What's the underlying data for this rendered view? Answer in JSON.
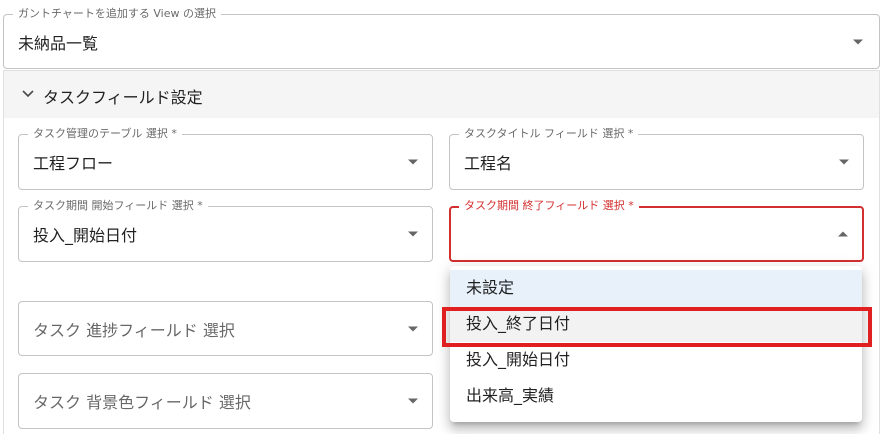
{
  "view_select": {
    "label": "ガントチャートを追加する View の選択",
    "value": "未納品一覧"
  },
  "section": {
    "title": "タスクフィールド設定"
  },
  "fields": {
    "task_table": {
      "label": "タスク管理のテーブル 選択 *",
      "value": "工程フロー"
    },
    "task_title": {
      "label": "タスクタイトル フィールド 選択 *",
      "value": "工程名"
    },
    "start_field": {
      "label": "タスク期間 開始フィールド 選択 *",
      "value": "投入_開始日付"
    },
    "end_field": {
      "label": "タスク期間 終了フィールド 選択 *",
      "value": ""
    },
    "progress_field": {
      "placeholder": "タスク 進捗フィールド 選択"
    },
    "bg_color_field": {
      "placeholder": "タスク 背景色フィールド 選択"
    }
  },
  "menu": {
    "items": [
      {
        "label": "未設定"
      },
      {
        "label": "投入_終了日付"
      },
      {
        "label": "投入_開始日付"
      },
      {
        "label": "出来高_実績"
      }
    ]
  },
  "colors": {
    "error": "#d32f2f",
    "highlight": "#e02020",
    "selected_bg": "#e8f0fa"
  }
}
